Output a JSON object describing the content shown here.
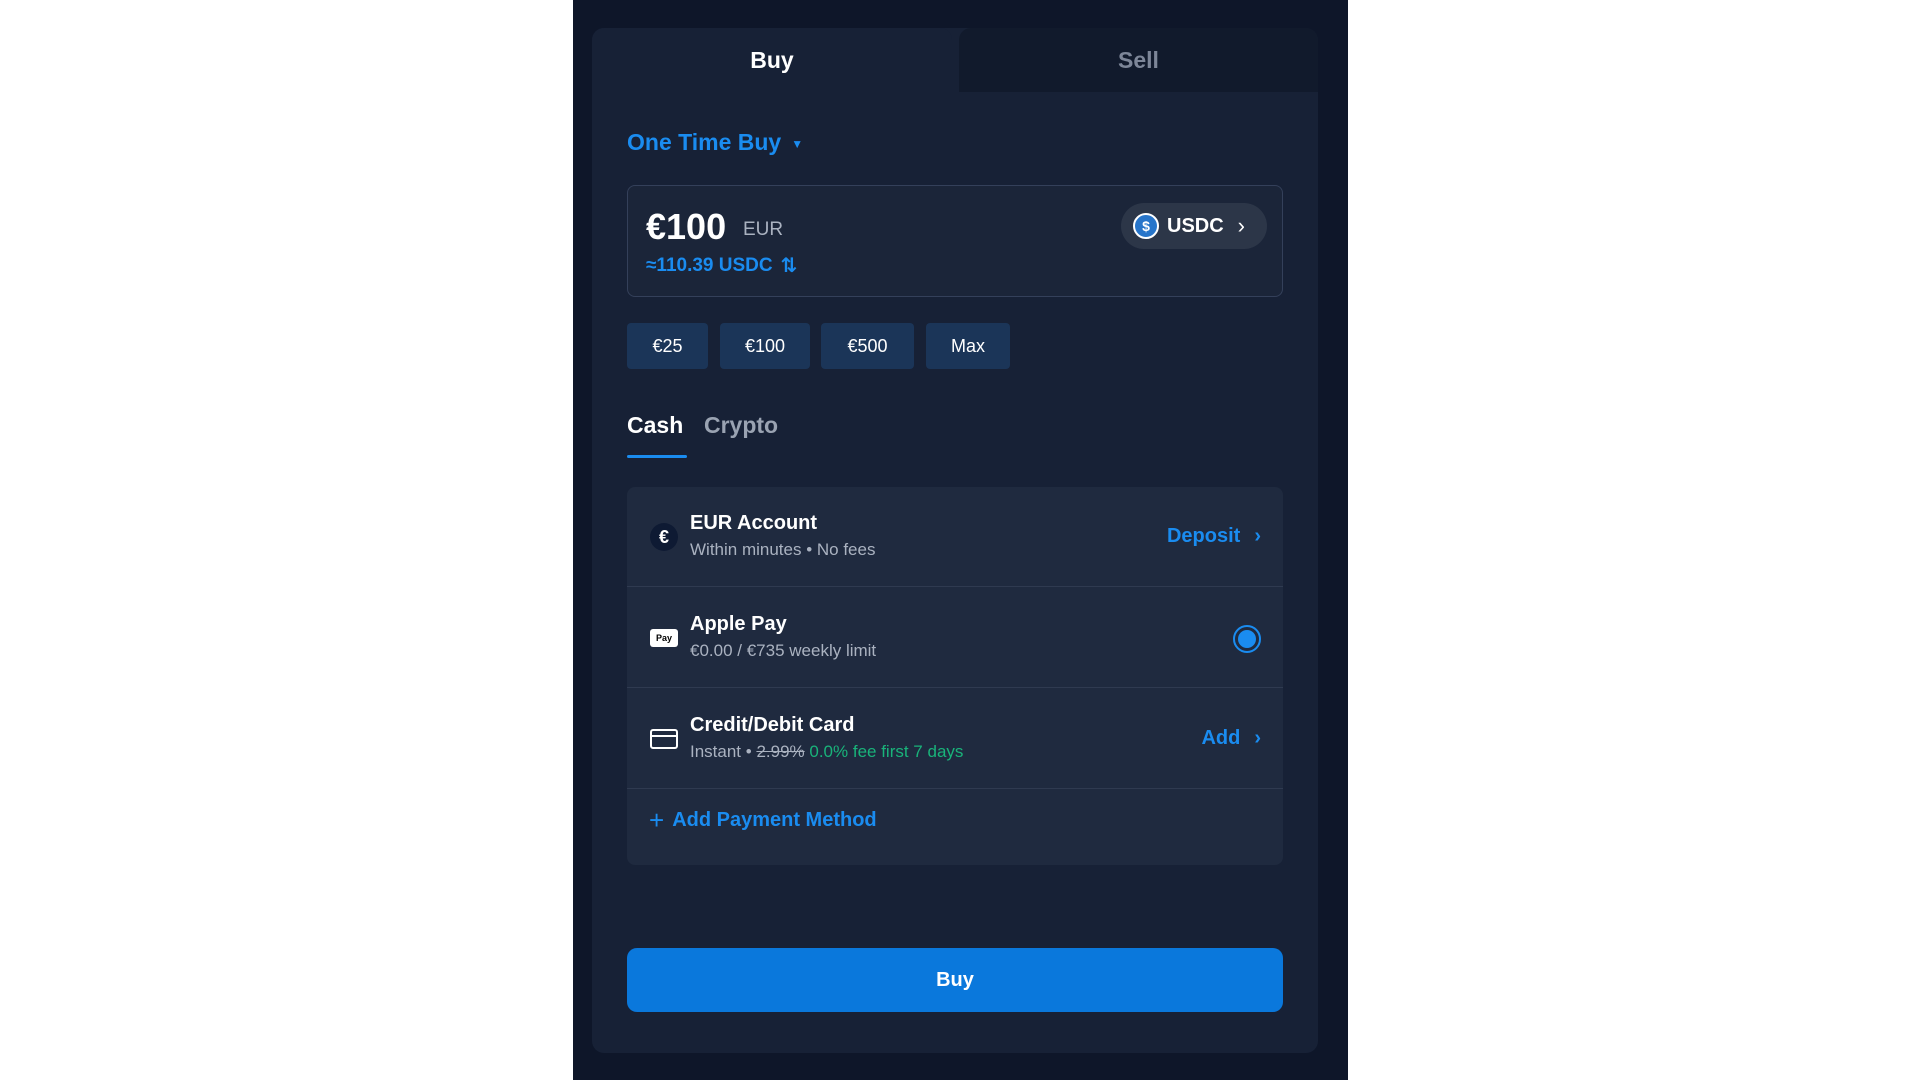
{
  "tabs": {
    "buy": "Buy",
    "sell": "Sell"
  },
  "mode": {
    "label": "One Time Buy",
    "caret_icon": "caret-down-icon"
  },
  "amount": {
    "value": "€100",
    "currency": "EUR",
    "converted": "≈110.39 USDC",
    "swap_icon": "swap-arrows-icon"
  },
  "asset": {
    "label": "USDC",
    "icon": "usdc-coin-icon"
  },
  "presets": [
    "€25",
    "€100",
    "€500",
    "Max"
  ],
  "payment_tabs": {
    "cash": "Cash",
    "crypto": "Crypto",
    "active": "Cash"
  },
  "methods": [
    {
      "title": "EUR Account",
      "subtitle": "Within minutes • No fees",
      "action": "Deposit",
      "icon": "euro-icon"
    },
    {
      "title": "Apple Pay",
      "subtitle": "€0.00 / €735 weekly limit",
      "selected": true,
      "icon": "apple-pay-icon"
    },
    {
      "title": "Credit/Debit Card",
      "subtitle_prefix": "Instant • ",
      "subtitle_strike": "2.99%",
      "subtitle_promo": "0.0% fee first 7 days",
      "action": "Add",
      "icon": "credit-card-icon"
    }
  ],
  "add_method": "Add Payment Method",
  "buy_button": "Buy",
  "colors": {
    "accent": "#1a8cf0",
    "promo": "#19b37a",
    "background": "#172136"
  }
}
